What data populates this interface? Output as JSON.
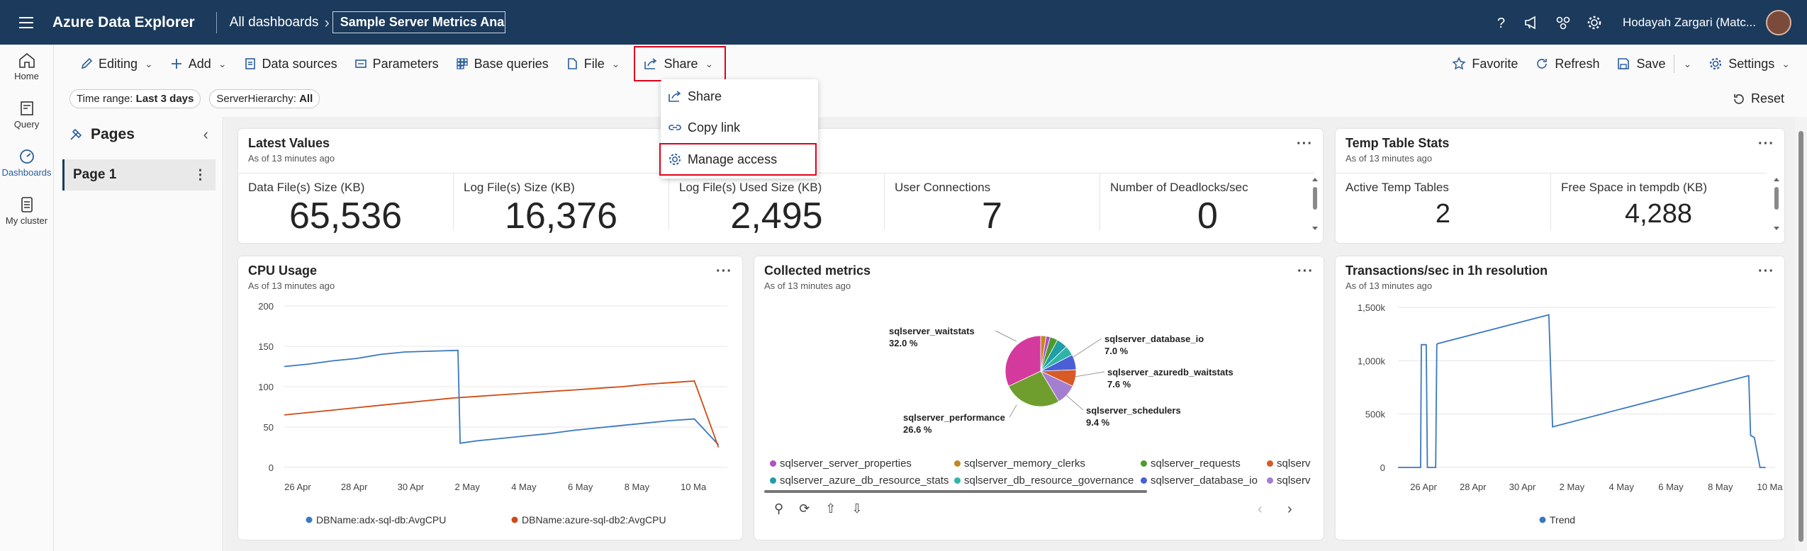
{
  "topbar": {
    "app_title": "Azure Data Explorer",
    "breadcrumb_root": "All dashboards",
    "dashboard_name": "Sample Server Metrics Anal",
    "user_name": "Hodayah Zargari (Matc..."
  },
  "leftnav": {
    "items": [
      {
        "label": "Home",
        "icon": "home-icon"
      },
      {
        "label": "Query",
        "icon": "query-icon"
      },
      {
        "label": "Dashboards",
        "icon": "dashboards-icon"
      },
      {
        "label": "My cluster",
        "icon": "cluster-icon"
      }
    ]
  },
  "toolbar": {
    "editing": "Editing",
    "add": "Add",
    "data_sources": "Data sources",
    "parameters": "Parameters",
    "base_queries": "Base queries",
    "file": "File",
    "share": "Share",
    "favorite": "Favorite",
    "refresh": "Refresh",
    "save": "Save",
    "settings": "Settings"
  },
  "share_menu": {
    "items": [
      "Share",
      "Copy link",
      "Manage access"
    ]
  },
  "filters": {
    "time_range_label": "Time range:",
    "time_range_value": "Last 3 days",
    "server_label": "ServerHierarchy:",
    "server_value": "All",
    "reset": "Reset"
  },
  "pages": {
    "title": "Pages",
    "items": [
      "Page 1"
    ]
  },
  "tiles": {
    "latest": {
      "title": "Latest Values",
      "subtitle": "As of 13 minutes ago",
      "kpis": [
        {
          "label": "Data File(s) Size (KB)",
          "value": "65,536"
        },
        {
          "label": "Log File(s) Size (KB)",
          "value": "16,376"
        },
        {
          "label": "Log File(s) Used Size (KB)",
          "value": "2,495"
        },
        {
          "label": "User Connections",
          "value": "7"
        },
        {
          "label": "Number of Deadlocks/sec",
          "value": "0"
        }
      ]
    },
    "temp": {
      "title": "Temp Table Stats",
      "subtitle": "As of 13 minutes ago",
      "kpis": [
        {
          "label": "Active Temp Tables",
          "value": "2"
        },
        {
          "label": "Free Space in tempdb (KB)",
          "value": "4,288"
        }
      ]
    },
    "cpu": {
      "title": "CPU Usage",
      "subtitle": "As of 13 minutes ago"
    },
    "collected": {
      "title": "Collected metrics",
      "subtitle": "As of 13 minutes ago"
    },
    "tx": {
      "title": "Transactions/sec in 1h resolution",
      "subtitle": "As of 13 minutes ago"
    }
  },
  "chart_data": [
    {
      "type": "line",
      "title": "CPU Usage",
      "x": [
        "26 Apr",
        "28 Apr",
        "30 Apr",
        "2 May",
        "4 May",
        "6 May",
        "8 May",
        "10 Ma"
      ],
      "ylim": [
        0,
        200
      ],
      "yticks": [
        "200",
        "150",
        "100",
        "50",
        "0"
      ],
      "series": [
        {
          "name": "DBName:adx-sql-db:AvgCPU",
          "color": "#3a78c2",
          "values": [
            125,
            128,
            132,
            135,
            140,
            143,
            145,
            30,
            33,
            36,
            39,
            42,
            46,
            49,
            52,
            55,
            58,
            60,
            28
          ]
        },
        {
          "name": "DBName:azure-sql-db2:AvgCPU",
          "color": "#d04a12",
          "values": [
            65,
            68,
            71,
            74,
            77,
            80,
            83,
            86,
            88,
            90,
            92,
            94,
            96,
            98,
            100,
            103,
            105,
            107,
            25
          ]
        }
      ]
    },
    {
      "type": "pie",
      "title": "Collected metrics",
      "slices": [
        {
          "label": "sqlserver_waitstats",
          "value": 32.0,
          "color": "#d43a9e"
        },
        {
          "label": "sqlserver_performance",
          "value": 26.6,
          "color": "#6f9e2e"
        },
        {
          "label": "sqlserver_schedulers",
          "value": 9.4,
          "color": "#a47fd1"
        },
        {
          "label": "sqlserver_azuredb_waitstats",
          "value": 7.6,
          "color": "#d85a26"
        },
        {
          "label": "sqlserver_database_io",
          "value": 7.0,
          "color": "#4a5fd6"
        },
        {
          "label": "sqlserver_azure_db_resource_stats",
          "value": 5.0,
          "color": "#1f9ea6"
        },
        {
          "label": "sqlserver_db_resource_governance",
          "value": 4.5,
          "color": "#2fb5a8"
        },
        {
          "label": "sqlserver_requests",
          "value": 3.5,
          "color": "#4e9a2c"
        },
        {
          "label": "sqlserver_memory_clerks",
          "value": 2.5,
          "color": "#c2891f"
        },
        {
          "label": "sqlserver_server_properties",
          "value": 1.9,
          "color": "#b04fc7"
        }
      ],
      "labelled": [
        {
          "name": "sqlserver_waitstats",
          "pct": "32.0 %"
        },
        {
          "name": "sqlserver_database_io",
          "pct": "7.0 %"
        },
        {
          "name": "sqlserver_azuredb_waitstats",
          "pct": "7.6 %"
        },
        {
          "name": "sqlserver_schedulers",
          "pct": "9.4 %"
        },
        {
          "name": "sqlserver_performance",
          "pct": "26.6 %"
        }
      ],
      "legend": [
        {
          "name": "sqlserver_server_properties",
          "color": "#b04fc7"
        },
        {
          "name": "sqlserver_memory_clerks",
          "color": "#c2891f"
        },
        {
          "name": "sqlserver_requests",
          "color": "#4e9a2c"
        },
        {
          "name": "sqlserv",
          "color": "#d85a26"
        },
        {
          "name": "sqlserver_azure_db_resource_stats",
          "color": "#1f9ea6"
        },
        {
          "name": "sqlserver_db_resource_governance",
          "color": "#2fb5a8"
        },
        {
          "name": "sqlserver_database_io",
          "color": "#4a5fd6"
        },
        {
          "name": "sqlserv",
          "color": "#a47fd1"
        }
      ]
    },
    {
      "type": "line",
      "title": "Transactions/sec in 1h resolution",
      "x": [
        "26 Apr",
        "28 Apr",
        "30 Apr",
        "2 May",
        "4 May",
        "6 May",
        "8 May",
        "10 Ma"
      ],
      "ylim": [
        0,
        1500000
      ],
      "yticks": [
        "1,500k",
        "1,000k",
        "500k",
        "0"
      ],
      "series": [
        {
          "name": "Trend",
          "color": "#3a78c2",
          "points": [
            [
              0,
              0
            ],
            [
              0.06,
              0
            ],
            [
              0.062,
              1150000
            ],
            [
              0.075,
              1150000
            ],
            [
              0.078,
              0
            ],
            [
              0.1,
              0
            ],
            [
              0.103,
              1150000
            ],
            [
              0.105,
              1160000
            ],
            [
              0.4,
              1430000
            ],
            [
              0.41,
              380000
            ],
            [
              0.93,
              860000
            ],
            [
              0.935,
              300000
            ],
            [
              0.945,
              280000
            ],
            [
              0.96,
              0
            ],
            [
              0.975,
              0
            ]
          ]
        }
      ]
    }
  ]
}
